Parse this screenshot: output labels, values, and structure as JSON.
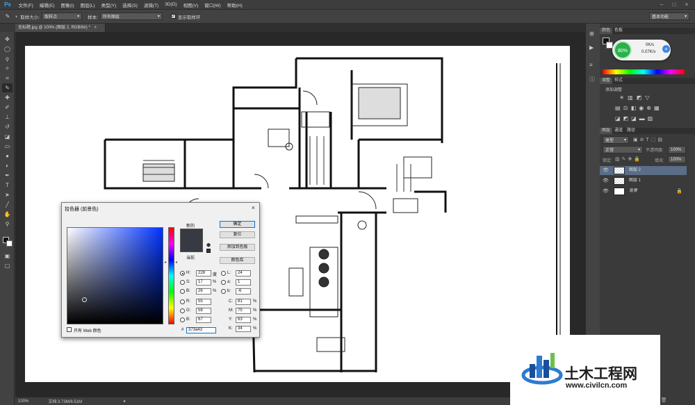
{
  "app": {
    "logo": "Ps"
  },
  "menu": [
    "文件(F)",
    "编辑(E)",
    "图像(I)",
    "图层(L)",
    "类型(Y)",
    "选择(S)",
    "滤镜(T)",
    "3D(D)",
    "视图(V)",
    "窗口(W)",
    "帮助(H)"
  ],
  "options": {
    "sample_size_label": "取样大小:",
    "sample_size_value": "取样点",
    "sample_label": "样本:",
    "sample_value": "所有图层",
    "show_ring_label": "显示取样环",
    "workspace": "基本功能"
  },
  "document": {
    "tab_title": "无标题.jpg @ 100% (图层 2, RGB/8#) *",
    "close": "×"
  },
  "status": {
    "zoom": "100%",
    "doc_info": "文档:3.73M/8.51M"
  },
  "color_panel": {
    "tabs": [
      "颜色",
      "色板"
    ],
    "speed_percent": "80%",
    "up_speed": "0K/s",
    "down_speed": "0.07K/s"
  },
  "adjust_panel": {
    "tabs": [
      "调整",
      "样式"
    ],
    "add_label": "添加调整"
  },
  "layers_panel": {
    "tabs": [
      "图层",
      "通道",
      "路径"
    ],
    "kind_label": "类型",
    "blend_mode": "正常",
    "opacity_label": "不透明度:",
    "opacity_value": "100%",
    "lock_label": "锁定:",
    "fill_label": "填充:",
    "fill_value": "100%",
    "layers": [
      {
        "name": "图层 2",
        "selected": true
      },
      {
        "name": "图层 1",
        "selected": false
      },
      {
        "name": "背景",
        "selected": false
      }
    ]
  },
  "color_picker": {
    "title": "拾色器 (前景色)",
    "ok": "确定",
    "reset": "复位",
    "add_swatch": "添加到色板",
    "color_libraries": "颜色库",
    "new_label": "新的",
    "current_label": "当前",
    "only_web": "只有 Web 颜色",
    "hex_label": "#",
    "hex": "373a43",
    "current_color": "#373a43",
    "fields": {
      "H": {
        "label": "H:",
        "value": "228",
        "unit": "度"
      },
      "S": {
        "label": "S:",
        "value": "17",
        "unit": "%"
      },
      "B": {
        "label": "B:",
        "value": "26",
        "unit": "%"
      },
      "R": {
        "label": "R:",
        "value": "55"
      },
      "G": {
        "label": "G:",
        "value": "58"
      },
      "Bl": {
        "label": "B:",
        "value": "67"
      },
      "L": {
        "label": "L:",
        "value": "24"
      },
      "a": {
        "label": "a:",
        "value": "1"
      },
      "b": {
        "label": "b:",
        "value": "-6"
      },
      "C": {
        "label": "C:",
        "value": "81",
        "unit": "%"
      },
      "M": {
        "label": "M:",
        "value": "75",
        "unit": "%"
      },
      "Y": {
        "label": "Y:",
        "value": "63",
        "unit": "%"
      },
      "K": {
        "label": "K:",
        "value": "34",
        "unit": "%"
      }
    }
  },
  "watermark": {
    "name": "土木工程网",
    "url": "www.civilcn.com"
  },
  "colors": {
    "accent": "#31a8ff",
    "picker_hue": "#0033ff",
    "selected_layer": "#5a6e87",
    "speed_green": "#29b24a"
  }
}
